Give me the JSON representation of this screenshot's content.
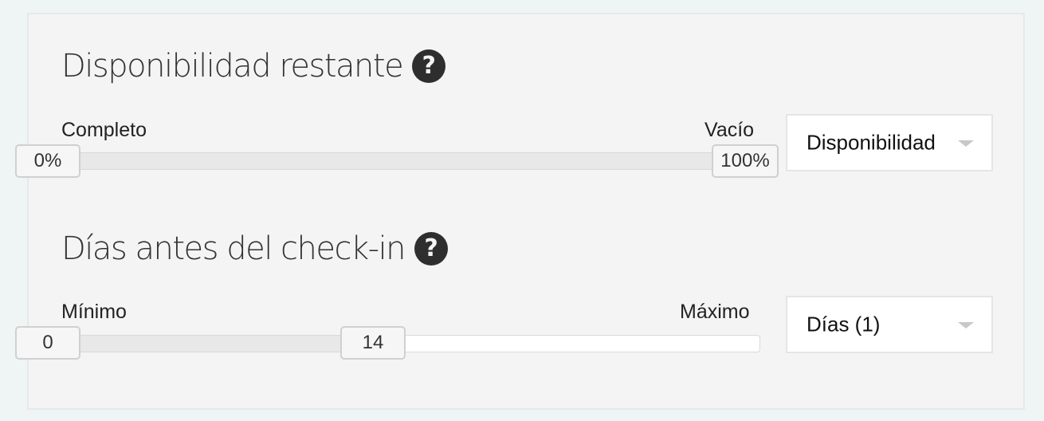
{
  "availability": {
    "title": "Disponibilidad restante",
    "help_icon": "question-circle-icon",
    "help_glyph": "?",
    "min_label": "Completo",
    "max_label": "Vacío",
    "low_handle": "0%",
    "high_handle": "100%",
    "range_fraction": [
      0,
      1
    ],
    "select_value": "Disponibilidad"
  },
  "days": {
    "title": "Días antes del check-in",
    "help_icon": "question-circle-icon",
    "help_glyph": "?",
    "min_label": "Mínimo",
    "max_label": "Máximo",
    "low_handle": "0",
    "high_handle": "14",
    "range_fraction": [
      0,
      0.45
    ],
    "select_value": "Días (1)"
  }
}
